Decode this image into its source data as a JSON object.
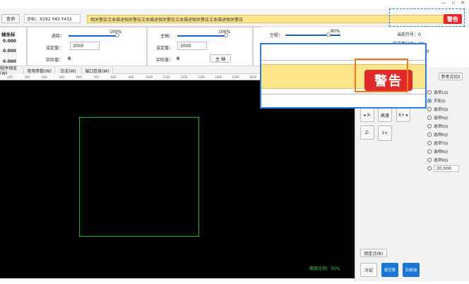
{
  "window": {
    "minimize": "—",
    "maximize": "▫",
    "close": "✕"
  },
  "topbar": {
    "query_label": "查询",
    "coord_text": "坐标：X192   Y45   Y432",
    "warning_text": "相关警告文本描述相关警告文本描述相关警告文本描述相关警告文本描述相关警告",
    "alarm_label": "警告"
  },
  "coords_panel": {
    "title": "械坐标",
    "values": [
      "0.000",
      "0.000",
      "0.000"
    ]
  },
  "feed": {
    "label": "进给：",
    "percent": "100%",
    "set_label": "设定值：",
    "set_value": "3000",
    "actual_label": "实际值：",
    "actual_value": "0",
    "level": 1.0
  },
  "spindle": {
    "label": "主轴：",
    "percent": "100%",
    "set_label": "设定值：",
    "set_value": "3000",
    "actual_label": "实际值：",
    "actual_value": "0",
    "button": "主 轴",
    "level": 1.0
  },
  "rapid": {
    "label": "空程：",
    "percent": "80%",
    "level": 0.8
  },
  "status": {
    "line_label": "当前行号：0",
    "percent_label": "完成百分比：0%",
    "time_value": "00"
  },
  "zoom": {
    "alarm_label": "警告"
  },
  "tabs": [
    "程序预览(W)",
    "常用参数(W)",
    "日志(W)",
    "端口信息(W)"
  ],
  "ruler_ticks": [
    "200",
    "300",
    "400",
    "500",
    "600",
    "700",
    "800",
    "900",
    "1000",
    "1100",
    "1200",
    "1300",
    "1400",
    "1500",
    "1600"
  ],
  "canvas": {
    "zoom_label": "缩放比例：30%"
  },
  "right_panel": {
    "ref_button": "参考点(D)",
    "jog": {
      "x_minus": "◂ X-",
      "fast": "高速",
      "x_plus": "X+ ▸",
      "z_minus": "Z-",
      "y_plus": "Y+"
    },
    "options": [
      "选项1(J)",
      "手轮(J)",
      "选项3(J)",
      "选项4(J)",
      "选项5(J)",
      "选项6(J)",
      "选项7(J)",
      "选项8(J)",
      "选项9(J)"
    ],
    "selected_option": 1,
    "custom_value": "20.000",
    "origin_button": "回定点(B)",
    "bottom_buttons": [
      "冷却",
      "真空泵",
      "后继油"
    ]
  }
}
